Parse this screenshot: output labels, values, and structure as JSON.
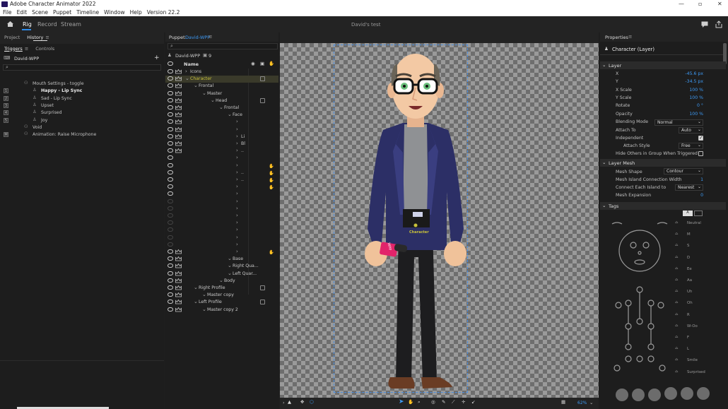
{
  "window": {
    "title": "Adobe Character Animator 2022"
  },
  "menu": [
    "File",
    "Edit",
    "Scene",
    "Puppet",
    "Timeline",
    "Window",
    "Help",
    "Version 22.2"
  ],
  "workspace": {
    "tabs": [
      "Rig",
      "Record",
      "Stream"
    ],
    "active": "Rig",
    "scene_title": "David's test"
  },
  "left_panel": {
    "tabs": [
      "Project",
      "History"
    ],
    "sub_tabs": [
      "Triggers",
      "Controls"
    ],
    "puppet": "David-WPP",
    "triggers": [
      {
        "key": "",
        "label": "Mouth Settings - toggle",
        "bold": false,
        "indent": 46
      },
      {
        "key": "1",
        "label": "Happy - Lip Sync",
        "bold": true,
        "indent": 58
      },
      {
        "key": "2",
        "label": "Sad - Lip Sync",
        "bold": false,
        "indent": 58
      },
      {
        "key": "3",
        "label": "Upset",
        "bold": false,
        "indent": 58
      },
      {
        "key": "4",
        "label": "Surprised",
        "bold": false,
        "indent": 58
      },
      {
        "key": "5",
        "label": "Joy",
        "bold": false,
        "indent": 58
      },
      {
        "key": "",
        "label": "Void",
        "bold": false,
        "indent": 46
      },
      {
        "key": "M",
        "label": "Animation: Raise Microphone",
        "bold": false,
        "indent": 46
      }
    ]
  },
  "puppet_panel": {
    "title_prefix": "Puppet:",
    "puppet": "David-WPP",
    "header_name": "David-WPP",
    "count": "9",
    "col_header": "Name",
    "rows": [
      {
        "label": "Icons",
        "indent": 0
      },
      {
        "label": "Character",
        "indent": 0
      },
      {
        "label": "Frontal",
        "indent": 1
      },
      {
        "label": "Master",
        "indent": 2
      },
      {
        "label": "Head",
        "indent": 3
      },
      {
        "label": "Frontal",
        "indent": 4
      },
      {
        "label": "Face",
        "indent": 5
      },
      {
        "label": "",
        "indent": 6
      },
      {
        "label": "",
        "indent": 6
      },
      {
        "label": "Li",
        "indent": 6
      },
      {
        "label": "Bl",
        "indent": 6
      },
      {
        "label": "..",
        "indent": 6
      },
      {
        "label": "",
        "indent": 6
      },
      {
        "label": "",
        "indent": 6
      },
      {
        "label": "..",
        "indent": 6
      },
      {
        "label": "..",
        "indent": 6
      },
      {
        "label": "",
        "indent": 6
      },
      {
        "label": "",
        "indent": 6
      },
      {
        "label": "",
        "indent": 6
      },
      {
        "label": "",
        "indent": 6
      },
      {
        "label": "",
        "indent": 6
      },
      {
        "label": "",
        "indent": 6
      },
      {
        "label": "",
        "indent": 6
      },
      {
        "label": "",
        "indent": 6
      },
      {
        "label": "",
        "indent": 6
      },
      {
        "label": "",
        "indent": 6
      },
      {
        "label": "Base",
        "indent": 5
      },
      {
        "label": "Right Qua...",
        "indent": 5
      },
      {
        "label": "Left Quar...",
        "indent": 5
      },
      {
        "label": "Body",
        "indent": 4
      },
      {
        "label": "Right Profile",
        "indent": 1
      },
      {
        "label": "Master copy",
        "indent": 2
      },
      {
        "label": "Left Profile",
        "indent": 1
      },
      {
        "label": "Master copy 2",
        "indent": 2
      }
    ]
  },
  "canvas": {
    "zoom": "62%",
    "handle_label": "Character",
    "mic_label": "WPP"
  },
  "properties": {
    "title": "Properties",
    "object": "Character (Layer)",
    "layer_section": "Layer",
    "layer": [
      {
        "label": "X",
        "value": "-45.6 px"
      },
      {
        "label": "Y",
        "value": "-34.5 px"
      },
      {
        "label": "X Scale",
        "value": "100 %"
      },
      {
        "label": "Y Scale",
        "value": "100 %"
      },
      {
        "label": "Rotate",
        "value": "0 °"
      },
      {
        "label": "Opacity",
        "value": "100 %"
      }
    ],
    "blending_label": "Blending Mode",
    "blending": "Normal",
    "attach_label": "Attach To",
    "attach": "Auto",
    "independent_label": "Independent",
    "attach_style_label": "Attach Style",
    "attach_style": "Free",
    "hide_others_label": "Hide Others in Group When Triggered",
    "mesh_section": "Layer Mesh",
    "mesh_shape_label": "Mesh Shape",
    "mesh_shape": "Contour",
    "island_width_label": "Mesh Island Connection Width",
    "island_width": "1",
    "connect_label": "Connect Each Island to",
    "connect": "Nearest",
    "expansion_label": "Mesh Expansion",
    "expansion": "0",
    "tags_section": "Tags",
    "tag_labels": [
      "Neutral",
      "M",
      "S",
      "D",
      "Ee",
      "Aa",
      "Uh",
      "Oh",
      "R",
      "W-Oo",
      "F",
      "L",
      "Smile",
      "Surprised"
    ]
  },
  "colors": {
    "accent": "#2d8ceb",
    "value": "#3d9af5",
    "highlight": "#c9c23a"
  }
}
